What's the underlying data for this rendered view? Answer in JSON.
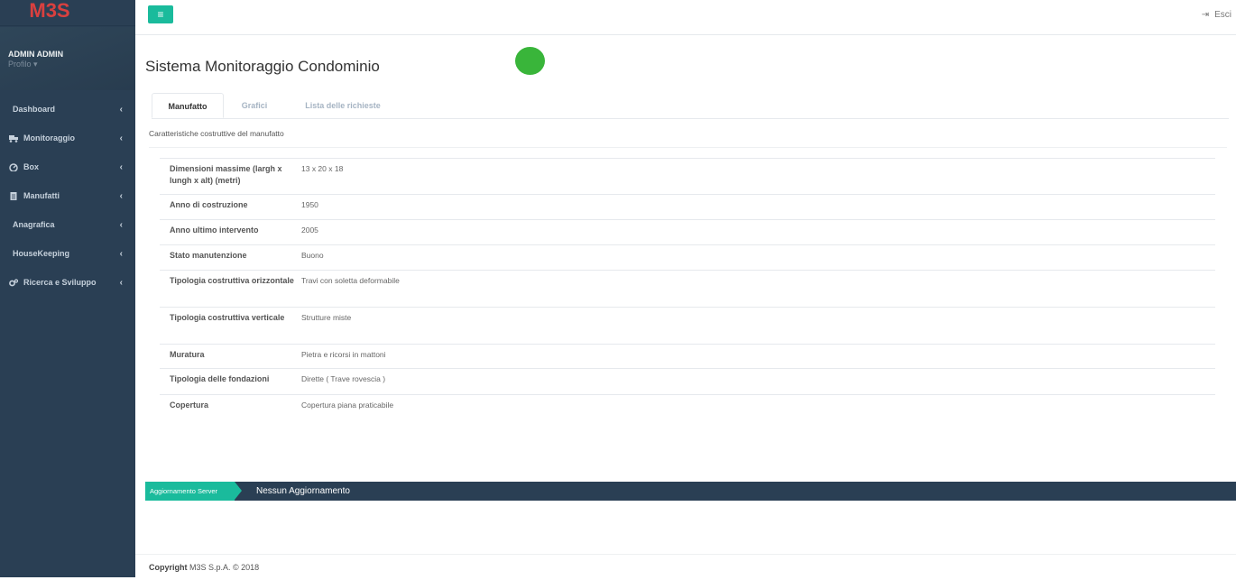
{
  "app": {
    "logo": "M3S"
  },
  "user": {
    "name": "ADMIN ADMIN",
    "profile_link": "Profilo ▾"
  },
  "topbar": {
    "logout_label": "Esci"
  },
  "sidebar": {
    "items": [
      {
        "label": "Dashboard",
        "icon": "none"
      },
      {
        "label": "Monitoraggio",
        "icon": "truck-icon"
      },
      {
        "label": "Box",
        "icon": "dashboard-icon"
      },
      {
        "label": "Manufatti",
        "icon": "document-icon"
      },
      {
        "label": "Anagrafica",
        "icon": "none"
      },
      {
        "label": "HouseKeeping",
        "icon": "none"
      },
      {
        "label": "Ricerca e Sviluppo",
        "icon": "cogs-icon"
      }
    ]
  },
  "main": {
    "title": "Sistema Monitoraggio Condominio",
    "status_color": "#39b53a",
    "tabs": [
      {
        "label": "Manufatto",
        "active": true
      },
      {
        "label": "Grafici",
        "active": false
      },
      {
        "label": "Lista delle richieste",
        "active": false
      }
    ],
    "section_title": "Caratteristiche costruttive del manufatto",
    "details": [
      {
        "label": "Dimensioni massime (largh x lungh x alt) (metri)",
        "value": "13  x  20  x  18"
      },
      {
        "label": "Anno di costruzione",
        "value": "1950"
      },
      {
        "label": "Anno ultimo intervento",
        "value": "2005"
      },
      {
        "label": "Stato manutenzione",
        "value": "Buono"
      },
      {
        "label": "Tipologia costruttiva orizzontale",
        "value": "Travi con soletta deformabile"
      },
      {
        "label": "Tipologia costruttiva verticale",
        "value": "Strutture miste"
      },
      {
        "label": "Muratura",
        "value": "Pietra e ricorsi in mattoni"
      },
      {
        "label": "Tipologia delle fondazioni",
        "value": "Dirette  ( Trave rovescia )"
      },
      {
        "label": "Copertura",
        "value": "Copertura piana praticabile"
      }
    ]
  },
  "notification": {
    "tag": "Aggiornamento Server",
    "message": "Nessun Aggiornamento"
  },
  "footer": {
    "copyright_label": "Copyright",
    "copyright_text": "M3S S.p.A. © 2018"
  },
  "colors": {
    "sidebar": "#2a3f54",
    "accent": "#1abb9c",
    "brand": "#d9403f"
  }
}
